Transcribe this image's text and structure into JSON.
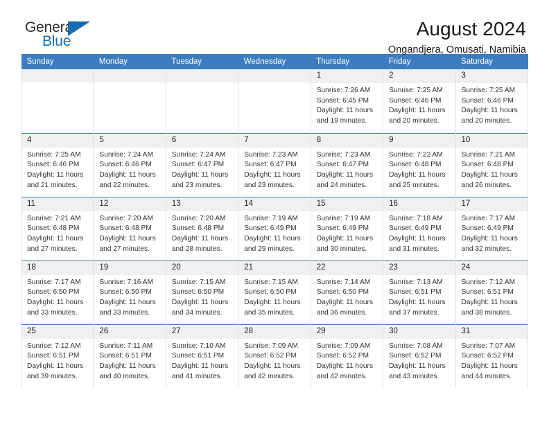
{
  "brand": {
    "word_general": "General",
    "word_blue": "Blue",
    "flag_icon": "triangle-flag-icon"
  },
  "header": {
    "title": "August 2024",
    "subtitle": "Ongandjera, Omusati, Namibia"
  },
  "calendar": {
    "weekday_headers": [
      "Sunday",
      "Monday",
      "Tuesday",
      "Wednesday",
      "Thursday",
      "Friday",
      "Saturday"
    ],
    "accent_color": "#3b7dbf",
    "daynum_band_color": "#f0f0f0",
    "weeks": [
      [
        {
          "day": "",
          "lines": [],
          "empty": true
        },
        {
          "day": "",
          "lines": [],
          "empty": true
        },
        {
          "day": "",
          "lines": [],
          "empty": true
        },
        {
          "day": "",
          "lines": [],
          "empty": true
        },
        {
          "day": "1",
          "lines": [
            "Sunrise: 7:26 AM",
            "Sunset: 6:45 PM",
            "Daylight: 11 hours",
            "and 19 minutes."
          ]
        },
        {
          "day": "2",
          "lines": [
            "Sunrise: 7:25 AM",
            "Sunset: 6:46 PM",
            "Daylight: 11 hours",
            "and 20 minutes."
          ]
        },
        {
          "day": "3",
          "lines": [
            "Sunrise: 7:25 AM",
            "Sunset: 6:46 PM",
            "Daylight: 11 hours",
            "and 20 minutes."
          ]
        }
      ],
      [
        {
          "day": "4",
          "lines": [
            "Sunrise: 7:25 AM",
            "Sunset: 6:46 PM",
            "Daylight: 11 hours",
            "and 21 minutes."
          ]
        },
        {
          "day": "5",
          "lines": [
            "Sunrise: 7:24 AM",
            "Sunset: 6:46 PM",
            "Daylight: 11 hours",
            "and 22 minutes."
          ]
        },
        {
          "day": "6",
          "lines": [
            "Sunrise: 7:24 AM",
            "Sunset: 6:47 PM",
            "Daylight: 11 hours",
            "and 23 minutes."
          ]
        },
        {
          "day": "7",
          "lines": [
            "Sunrise: 7:23 AM",
            "Sunset: 6:47 PM",
            "Daylight: 11 hours",
            "and 23 minutes."
          ]
        },
        {
          "day": "8",
          "lines": [
            "Sunrise: 7:23 AM",
            "Sunset: 6:47 PM",
            "Daylight: 11 hours",
            "and 24 minutes."
          ]
        },
        {
          "day": "9",
          "lines": [
            "Sunrise: 7:22 AM",
            "Sunset: 6:48 PM",
            "Daylight: 11 hours",
            "and 25 minutes."
          ]
        },
        {
          "day": "10",
          "lines": [
            "Sunrise: 7:21 AM",
            "Sunset: 6:48 PM",
            "Daylight: 11 hours",
            "and 26 minutes."
          ]
        }
      ],
      [
        {
          "day": "11",
          "lines": [
            "Sunrise: 7:21 AM",
            "Sunset: 6:48 PM",
            "Daylight: 11 hours",
            "and 27 minutes."
          ]
        },
        {
          "day": "12",
          "lines": [
            "Sunrise: 7:20 AM",
            "Sunset: 6:48 PM",
            "Daylight: 11 hours",
            "and 27 minutes."
          ]
        },
        {
          "day": "13",
          "lines": [
            "Sunrise: 7:20 AM",
            "Sunset: 6:48 PM",
            "Daylight: 11 hours",
            "and 28 minutes."
          ]
        },
        {
          "day": "14",
          "lines": [
            "Sunrise: 7:19 AM",
            "Sunset: 6:49 PM",
            "Daylight: 11 hours",
            "and 29 minutes."
          ]
        },
        {
          "day": "15",
          "lines": [
            "Sunrise: 7:19 AM",
            "Sunset: 6:49 PM",
            "Daylight: 11 hours",
            "and 30 minutes."
          ]
        },
        {
          "day": "16",
          "lines": [
            "Sunrise: 7:18 AM",
            "Sunset: 6:49 PM",
            "Daylight: 11 hours",
            "and 31 minutes."
          ]
        },
        {
          "day": "17",
          "lines": [
            "Sunrise: 7:17 AM",
            "Sunset: 6:49 PM",
            "Daylight: 11 hours",
            "and 32 minutes."
          ]
        }
      ],
      [
        {
          "day": "18",
          "lines": [
            "Sunrise: 7:17 AM",
            "Sunset: 6:50 PM",
            "Daylight: 11 hours",
            "and 33 minutes."
          ]
        },
        {
          "day": "19",
          "lines": [
            "Sunrise: 7:16 AM",
            "Sunset: 6:50 PM",
            "Daylight: 11 hours",
            "and 33 minutes."
          ]
        },
        {
          "day": "20",
          "lines": [
            "Sunrise: 7:15 AM",
            "Sunset: 6:50 PM",
            "Daylight: 11 hours",
            "and 34 minutes."
          ]
        },
        {
          "day": "21",
          "lines": [
            "Sunrise: 7:15 AM",
            "Sunset: 6:50 PM",
            "Daylight: 11 hours",
            "and 35 minutes."
          ]
        },
        {
          "day": "22",
          "lines": [
            "Sunrise: 7:14 AM",
            "Sunset: 6:50 PM",
            "Daylight: 11 hours",
            "and 36 minutes."
          ]
        },
        {
          "day": "23",
          "lines": [
            "Sunrise: 7:13 AM",
            "Sunset: 6:51 PM",
            "Daylight: 11 hours",
            "and 37 minutes."
          ]
        },
        {
          "day": "24",
          "lines": [
            "Sunrise: 7:12 AM",
            "Sunset: 6:51 PM",
            "Daylight: 11 hours",
            "and 38 minutes."
          ]
        }
      ],
      [
        {
          "day": "25",
          "lines": [
            "Sunrise: 7:12 AM",
            "Sunset: 6:51 PM",
            "Daylight: 11 hours",
            "and 39 minutes."
          ]
        },
        {
          "day": "26",
          "lines": [
            "Sunrise: 7:11 AM",
            "Sunset: 6:51 PM",
            "Daylight: 11 hours",
            "and 40 minutes."
          ]
        },
        {
          "day": "27",
          "lines": [
            "Sunrise: 7:10 AM",
            "Sunset: 6:51 PM",
            "Daylight: 11 hours",
            "and 41 minutes."
          ]
        },
        {
          "day": "28",
          "lines": [
            "Sunrise: 7:09 AM",
            "Sunset: 6:52 PM",
            "Daylight: 11 hours",
            "and 42 minutes."
          ]
        },
        {
          "day": "29",
          "lines": [
            "Sunrise: 7:09 AM",
            "Sunset: 6:52 PM",
            "Daylight: 11 hours",
            "and 42 minutes."
          ]
        },
        {
          "day": "30",
          "lines": [
            "Sunrise: 7:08 AM",
            "Sunset: 6:52 PM",
            "Daylight: 11 hours",
            "and 43 minutes."
          ]
        },
        {
          "day": "31",
          "lines": [
            "Sunrise: 7:07 AM",
            "Sunset: 6:52 PM",
            "Daylight: 11 hours",
            "and 44 minutes."
          ]
        }
      ]
    ]
  }
}
